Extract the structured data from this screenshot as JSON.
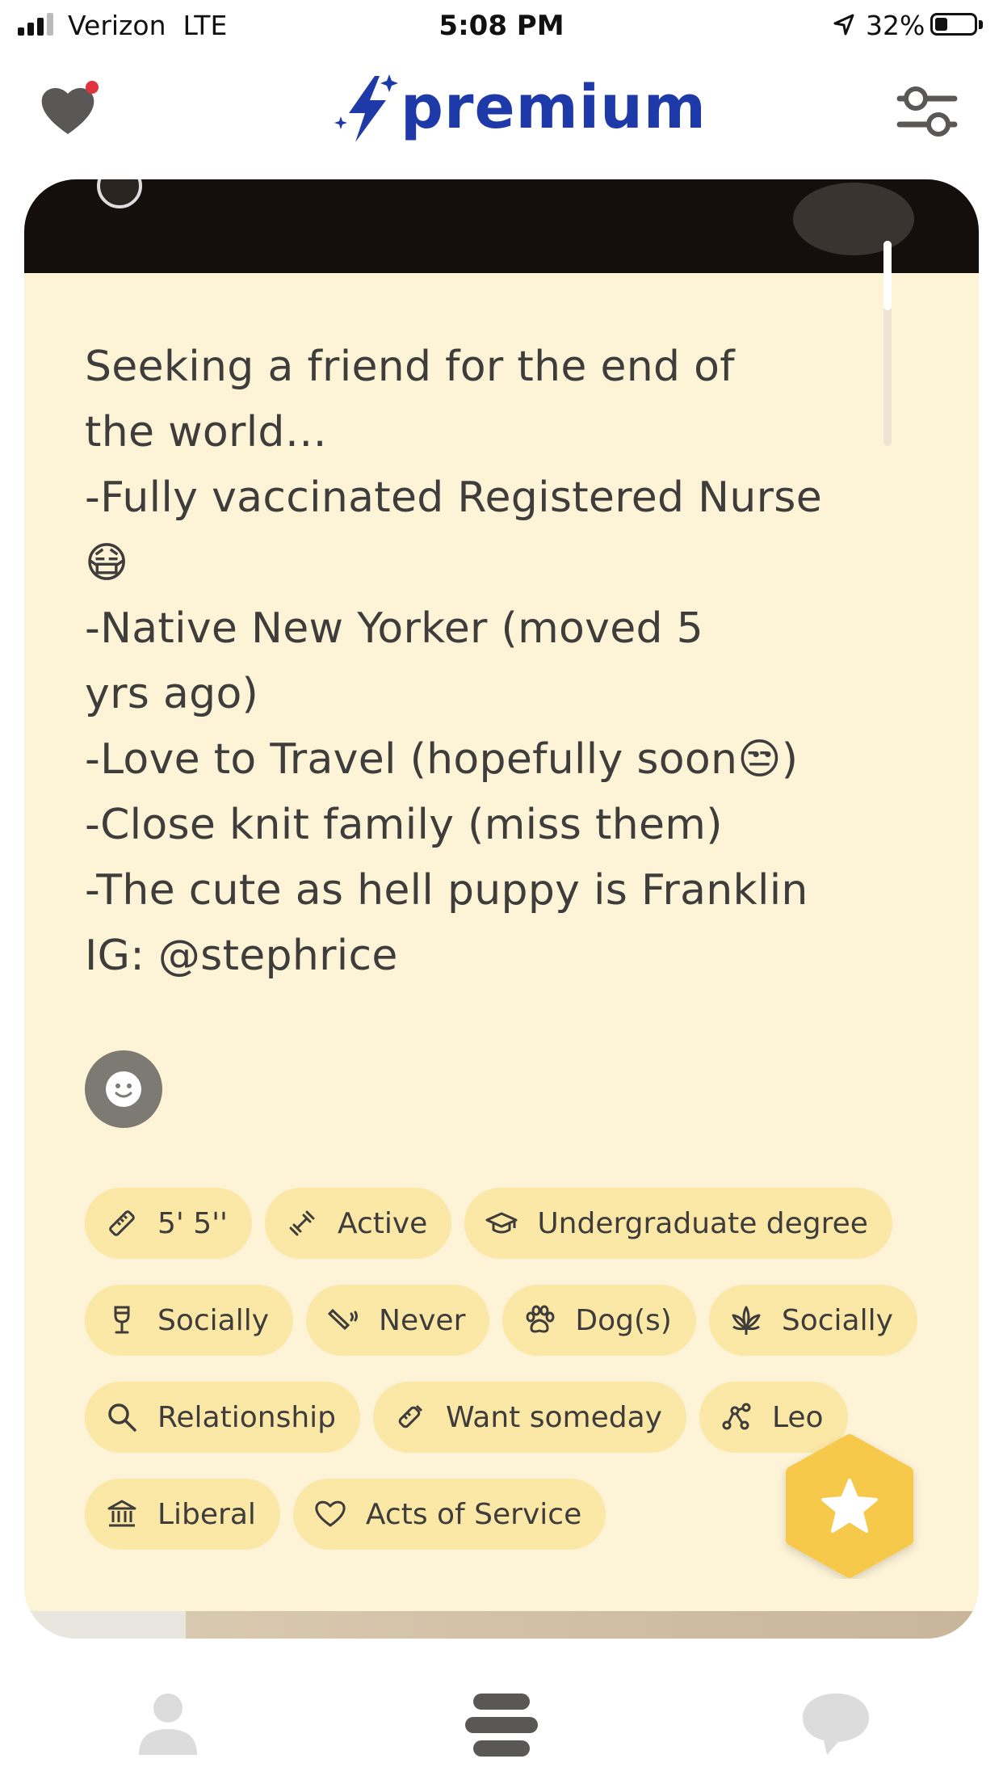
{
  "status_bar": {
    "carrier": "Verizon  LTE",
    "time": "5:08 PM",
    "battery": "32%"
  },
  "header": {
    "brand": "premium",
    "accent": "#1e3aa8",
    "icons": [
      "likes-heart-icon",
      "bolt-sparkle-icon",
      "filter-sliders-icon"
    ]
  },
  "profile": {
    "bio_lines": [
      "Seeking a friend for the end of",
      "the world…",
      "-Fully vaccinated Registered Nurse",
      "😷",
      "-Native New Yorker (moved 5",
      "yrs ago)",
      "-Love to Travel (hopefully soon😒)",
      "-Close knit family (miss them)",
      "-The cute as hell puppy is Franklin",
      "IG: @stephrice"
    ],
    "chips": [
      [
        {
          "icon": "ruler-icon",
          "label": "5' 5''"
        },
        {
          "icon": "dumbbell-icon",
          "label": "Active"
        },
        {
          "icon": "graduation-cap-icon",
          "label": "Undergraduate degree"
        }
      ],
      [
        {
          "icon": "wine-glass-icon",
          "label": "Socially"
        },
        {
          "icon": "cigarette-icon",
          "label": "Never"
        },
        {
          "icon": "paw-icon",
          "label": "Dog(s)"
        },
        {
          "icon": "cannabis-leaf-icon",
          "label": "Socially"
        }
      ],
      [
        {
          "icon": "magnifier-icon",
          "label": "Relationship"
        },
        {
          "icon": "baby-bottle-icon",
          "label": "Want someday"
        },
        {
          "icon": "constellation-icon",
          "label": "Leo"
        }
      ],
      [
        {
          "icon": "government-building-icon",
          "label": "Liberal"
        },
        {
          "icon": "heart-outline-icon",
          "label": "Acts of Service"
        }
      ]
    ],
    "card_color": "#fdf3d7",
    "chip_color": "#fbe7a6",
    "superswipe_color": "#f6c94c"
  },
  "tabbar": {
    "items": [
      "profile-tab",
      "people-tab",
      "chats-tab"
    ]
  }
}
